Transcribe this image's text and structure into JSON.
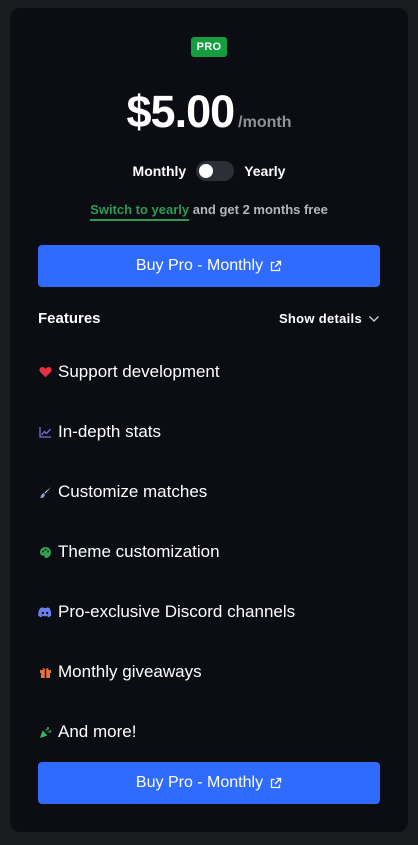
{
  "plan": {
    "badge": "PRO",
    "price": "$5.00",
    "period": "/month"
  },
  "billing": {
    "monthly_label": "Monthly",
    "yearly_label": "Yearly",
    "yearly_selected": false
  },
  "promo": {
    "link_text": "Switch to yearly",
    "rest_text": " and get 2 months free"
  },
  "buy_button": {
    "label": "Buy Pro - Monthly"
  },
  "features": {
    "title": "Features",
    "details_label": "Show details",
    "items": [
      {
        "label": "Support development",
        "icon": "heart-icon",
        "color": "#e5303f"
      },
      {
        "label": "In-depth stats",
        "icon": "chart-line-icon",
        "color": "#7b6bd6"
      },
      {
        "label": "Customize matches",
        "icon": "brush-icon",
        "color": "#8da2c8"
      },
      {
        "label": "Theme customization",
        "icon": "palette-icon",
        "color": "#2ea44f"
      },
      {
        "label": "Pro-exclusive Discord channels",
        "icon": "discord-icon",
        "color": "#6b7ff0"
      },
      {
        "label": "Monthly giveaways",
        "icon": "gift-icon",
        "color": "#e8733a"
      },
      {
        "label": "And more!",
        "icon": "confetti-icon",
        "color": "#3bb55f"
      }
    ]
  },
  "colors": {
    "accent": "#2f6bff",
    "badge_green": "#159e3f",
    "link_green": "#2f9a55",
    "card_bg": "#0b0d13",
    "page_bg": "#1a1b1f"
  }
}
